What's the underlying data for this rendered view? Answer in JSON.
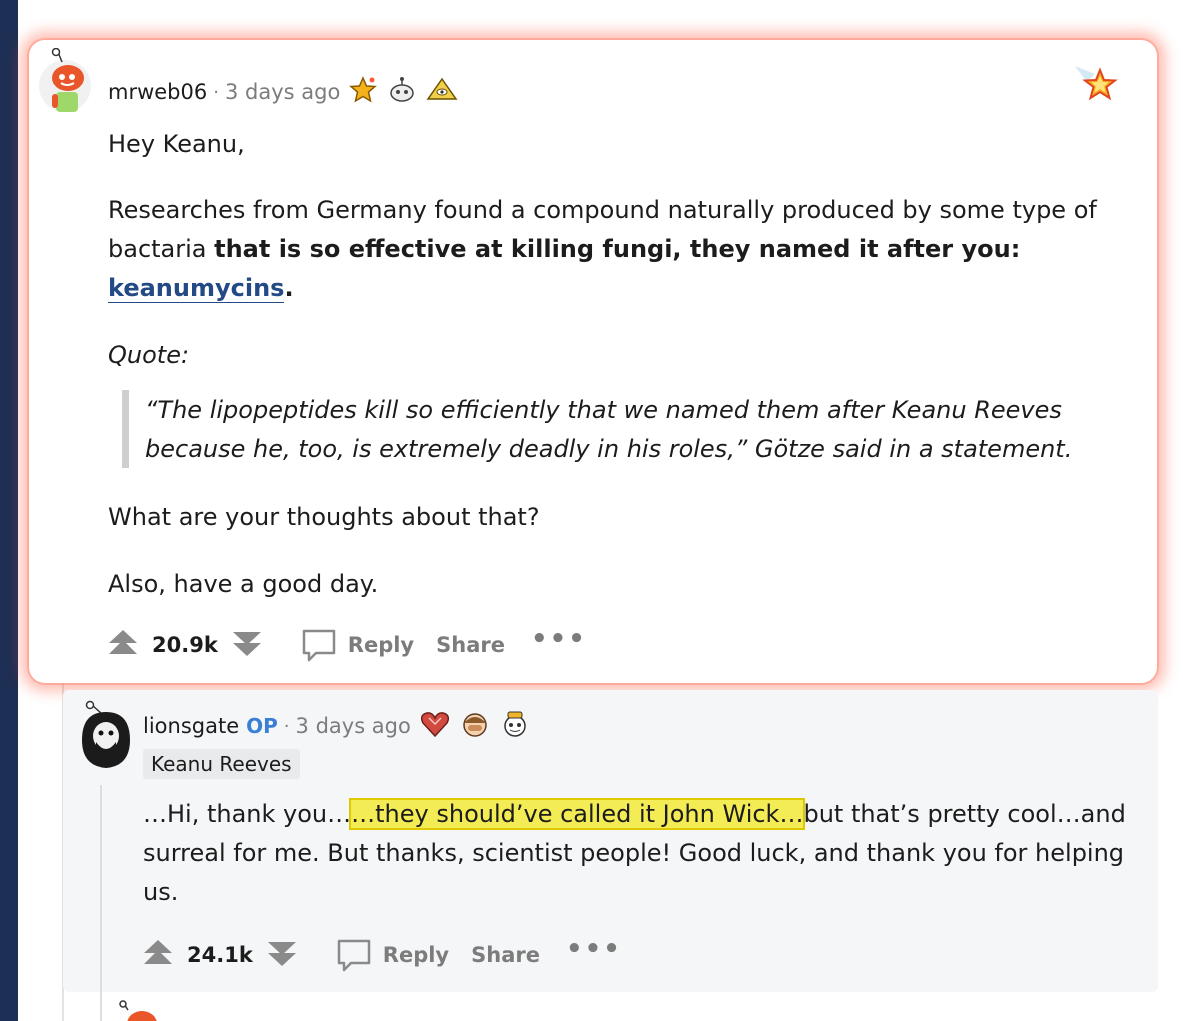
{
  "parent_comment": {
    "username": "mrweb06",
    "separator": "·",
    "time": "3 days ago",
    "awards": [
      "star-award-icon",
      "robot-award-icon",
      "eye-pyramid-award-icon"
    ],
    "corner_award": "starstruck-award-icon",
    "greeting": "Hey Keanu,",
    "para1_start": "Researches from Germany found a compound naturally produced by some type of bactaria ",
    "para1_bold": "that is so effective at killing fungi, they named it after you:",
    "para1_link": "keanumycins",
    "para1_end": ".",
    "quote_label": "Quote:",
    "quote_text": "“The lipopeptides kill so efficiently that we named them after Keanu Reeves because he, too, is extremely deadly in his roles,” Götze said in a statement.",
    "question": "What are your thoughts about that?",
    "closing": "Also, have a good day.",
    "score": "20.9k",
    "reply_label": "Reply",
    "share_label": "Share",
    "more_label": "•••"
  },
  "reply_comment": {
    "username": "lionsgate",
    "op_badge": "OP",
    "separator": "·",
    "time": "3 days ago",
    "awards": [
      "heart-gem-award-icon",
      "facepalm-award-icon",
      "snoo-award-icon"
    ],
    "flair": "Keanu Reeves",
    "text_before": "…Hi, thank you…",
    "text_highlight": "…they should’ve called it John Wick…",
    "text_after": "but that’s pretty cool…and surreal for me. But thanks, scientist people! Good luck, and thank you for helping us.",
    "score": "24.1k",
    "reply_label": "Reply",
    "share_label": "Share",
    "more_label": "•••"
  },
  "colors": {
    "highlight": "#f3ec55",
    "link": "#234a84",
    "op": "#3a7fd6",
    "glow": "#ff6a4d"
  }
}
